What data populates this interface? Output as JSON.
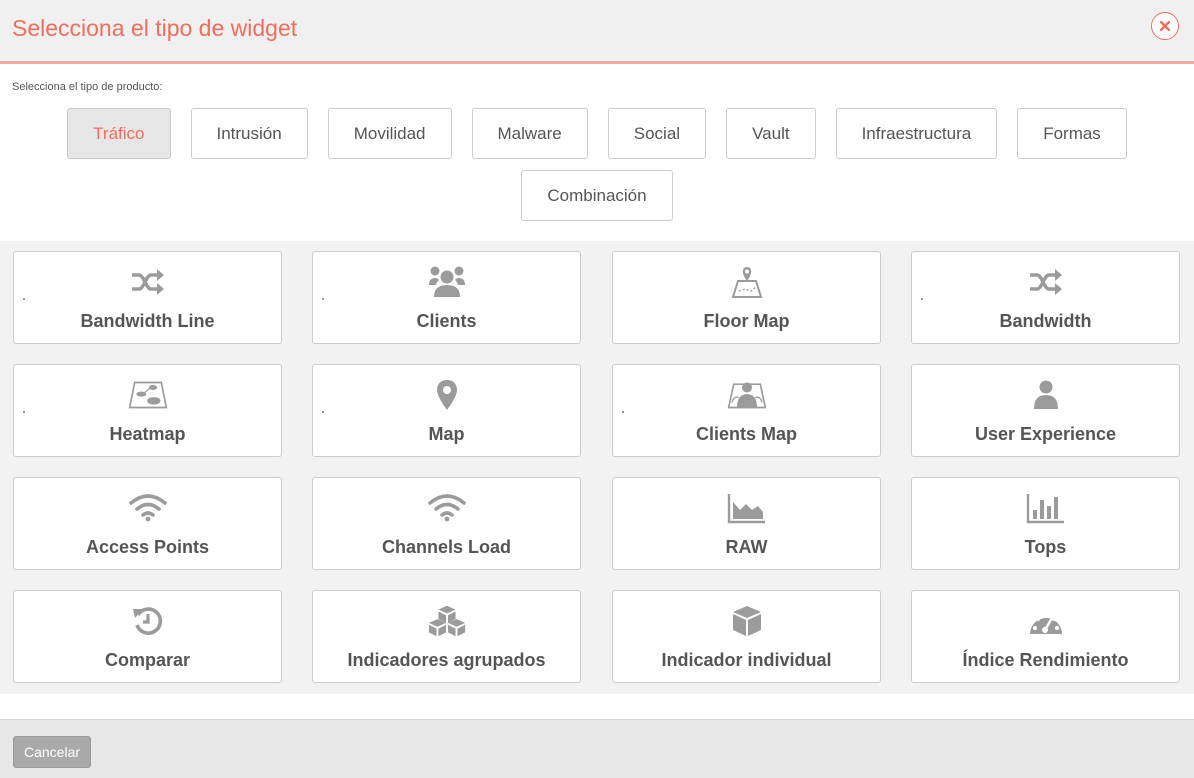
{
  "header": {
    "title": "Selecciona el tipo de widget"
  },
  "product_label": "Selecciona el tipo de producto:",
  "tabs": [
    {
      "label": "Tráfico",
      "active": true
    },
    {
      "label": "Intrusión"
    },
    {
      "label": "Movilidad"
    },
    {
      "label": "Malware"
    },
    {
      "label": "Social"
    },
    {
      "label": "Vault"
    },
    {
      "label": "Infraestructura"
    },
    {
      "label": "Formas"
    },
    {
      "label": "Combinación"
    }
  ],
  "widgets": [
    {
      "label": "Bandwidth Line",
      "icon": "shuffle-icon"
    },
    {
      "label": "Clients",
      "icon": "users-icon"
    },
    {
      "label": "Floor Map",
      "icon": "floor-map-icon"
    },
    {
      "label": "Bandwidth",
      "icon": "shuffle-icon"
    },
    {
      "label": "Heatmap",
      "icon": "heatmap-icon"
    },
    {
      "label": "Map",
      "icon": "map-marker-icon"
    },
    {
      "label": "Clients Map",
      "icon": "clients-map-icon"
    },
    {
      "label": "User Experience",
      "icon": "user-icon"
    },
    {
      "label": "Access Points",
      "icon": "wifi-icon"
    },
    {
      "label": "Channels Load",
      "icon": "wifi-icon"
    },
    {
      "label": "RAW",
      "icon": "area-chart-icon"
    },
    {
      "label": "Tops",
      "icon": "bar-chart-icon"
    },
    {
      "label": "Comparar",
      "icon": "history-icon"
    },
    {
      "label": "Indicadores agrupados",
      "icon": "cubes-icon"
    },
    {
      "label": "Indicador individual",
      "icon": "cube-icon"
    },
    {
      "label": "Índice Rendimiento",
      "icon": "dashboard-gauge-icon"
    }
  ],
  "footer": {
    "cancel_label": "Cancelar"
  },
  "colors": {
    "accent": "#ef6f5c",
    "icon": "#9b9b9b",
    "text": "#555555"
  }
}
